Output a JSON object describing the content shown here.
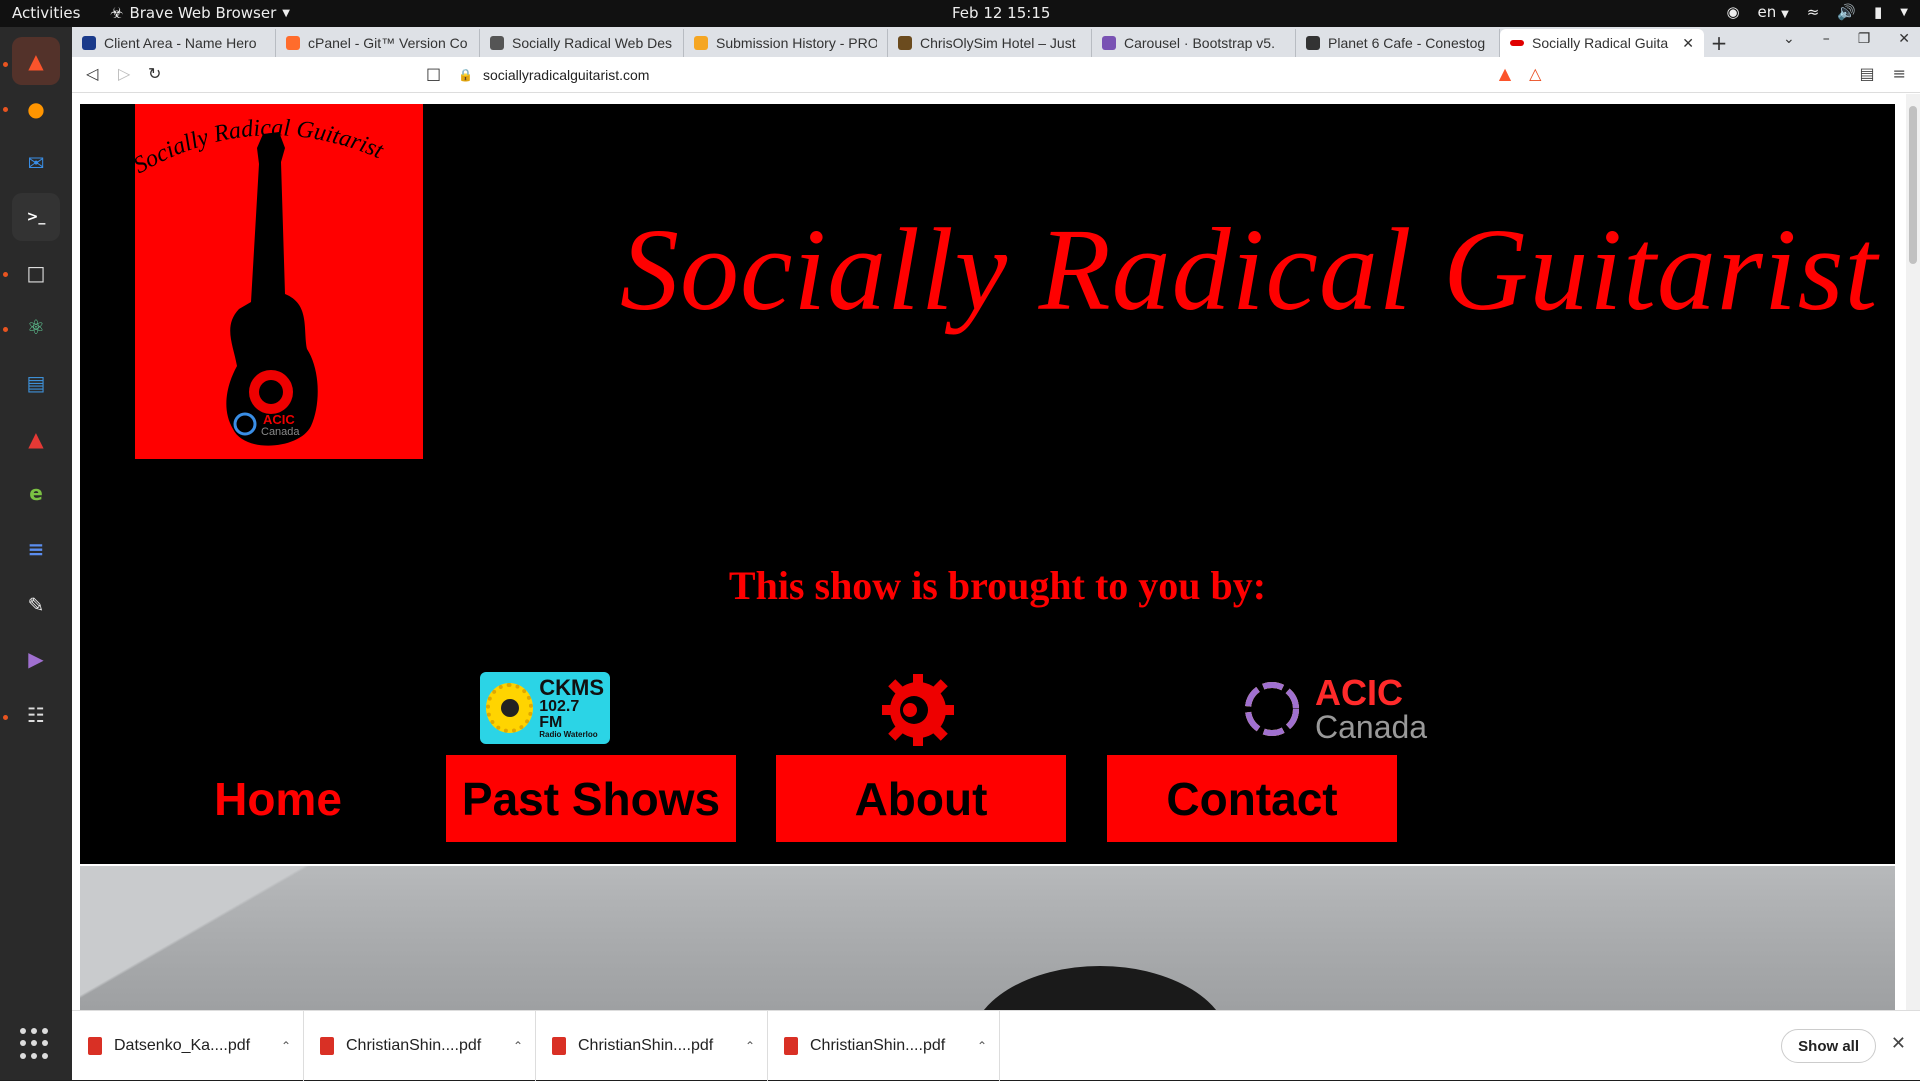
{
  "system": {
    "activities": "Activities",
    "app_menu": "Brave Web Browser",
    "clock": "Feb 12  15:15",
    "language": "en"
  },
  "browser": {
    "tabs": [
      {
        "title": "Client Area - Name Hero",
        "color": "#1a3a8a"
      },
      {
        "title": "cPanel - Git™ Version Co",
        "color": "#ff6c2c"
      },
      {
        "title": "Socially Radical Web Des",
        "color": "#555555"
      },
      {
        "title": "Submission History - PRO",
        "color": "#f5a623"
      },
      {
        "title": "ChrisOlySim Hotel – Just",
        "color": "#6b4b1e"
      },
      {
        "title": "Carousel · Bootstrap v5.",
        "color": "#7952b3"
      },
      {
        "title": "Planet 6 Cafe - Conestog",
        "color": "#333333"
      },
      {
        "title": "Socially Radical Guita",
        "color": "#e00000"
      }
    ],
    "url": "sociallyradicalguitarist.com"
  },
  "site": {
    "logo_text": "Socially Radical Guitarist",
    "logo_badge": "ACIC",
    "logo_badge_sub": "Canada",
    "title": "Socially Radical Guitarist",
    "sponsor_heading": "This show is brought to you by:",
    "sponsors": {
      "ckms_line1": "CKMS",
      "ckms_line2": "102.7 FM",
      "ckms_line3": "Radio Waterloo",
      "acic_line1": "ACIC",
      "acic_line2": "Canada"
    },
    "nav": {
      "home": "Home",
      "past_shows": "Past Shows",
      "about": "About",
      "contact": "Contact"
    },
    "colors": {
      "accent": "#ff0000",
      "background": "#000000"
    }
  },
  "downloads": {
    "items": [
      {
        "name": "Datsenko_Ka....pdf"
      },
      {
        "name": "ChristianShin....pdf"
      },
      {
        "name": "ChristianShin....pdf"
      },
      {
        "name": "ChristianShin....pdf"
      }
    ],
    "show_all": "Show all"
  }
}
